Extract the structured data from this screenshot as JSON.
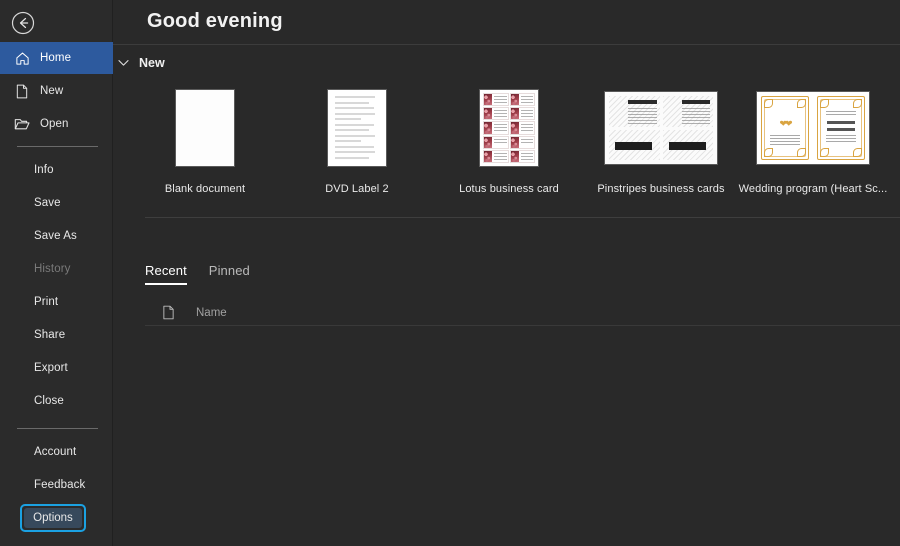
{
  "window": {
    "back_button": "Back",
    "greeting": "Good evening"
  },
  "sidebar": {
    "nav": [
      {
        "label": "Home",
        "icon": "home-icon",
        "active": true
      },
      {
        "label": "New",
        "icon": "new-document-icon",
        "active": false
      },
      {
        "label": "Open",
        "icon": "open-folder-icon",
        "active": false
      }
    ],
    "menu": [
      {
        "label": "Info",
        "disabled": false
      },
      {
        "label": "Save",
        "disabled": false
      },
      {
        "label": "Save As",
        "disabled": false
      },
      {
        "label": "History",
        "disabled": true
      },
      {
        "label": "Print",
        "disabled": false
      },
      {
        "label": "Share",
        "disabled": false
      },
      {
        "label": "Export",
        "disabled": false
      },
      {
        "label": "Close",
        "disabled": false
      }
    ],
    "footer": [
      {
        "label": "Account"
      },
      {
        "label": "Feedback"
      }
    ],
    "options_button": "Options",
    "colors": {
      "active_nav": "#2d5a9e",
      "focus_ring": "#1ba1e2",
      "sidebar_bg": "#2b2b2b"
    }
  },
  "main": {
    "new_section": {
      "label": "New",
      "chevron": "chevron-down-icon",
      "templates": [
        {
          "label": "Blank document",
          "kind": "blank"
        },
        {
          "label": "DVD Label 2",
          "kind": "lines"
        },
        {
          "label": "Lotus business card",
          "kind": "lotus"
        },
        {
          "label": "Pinstripes business cards",
          "kind": "pinstripes"
        },
        {
          "label": "Wedding program (Heart Sc...",
          "kind": "wedding"
        }
      ]
    },
    "tabs": [
      {
        "label": "Recent",
        "active": true
      },
      {
        "label": "Pinned",
        "active": false
      }
    ],
    "recent_list": {
      "icon": "document-icon",
      "column_name": "Name",
      "rows": []
    }
  }
}
